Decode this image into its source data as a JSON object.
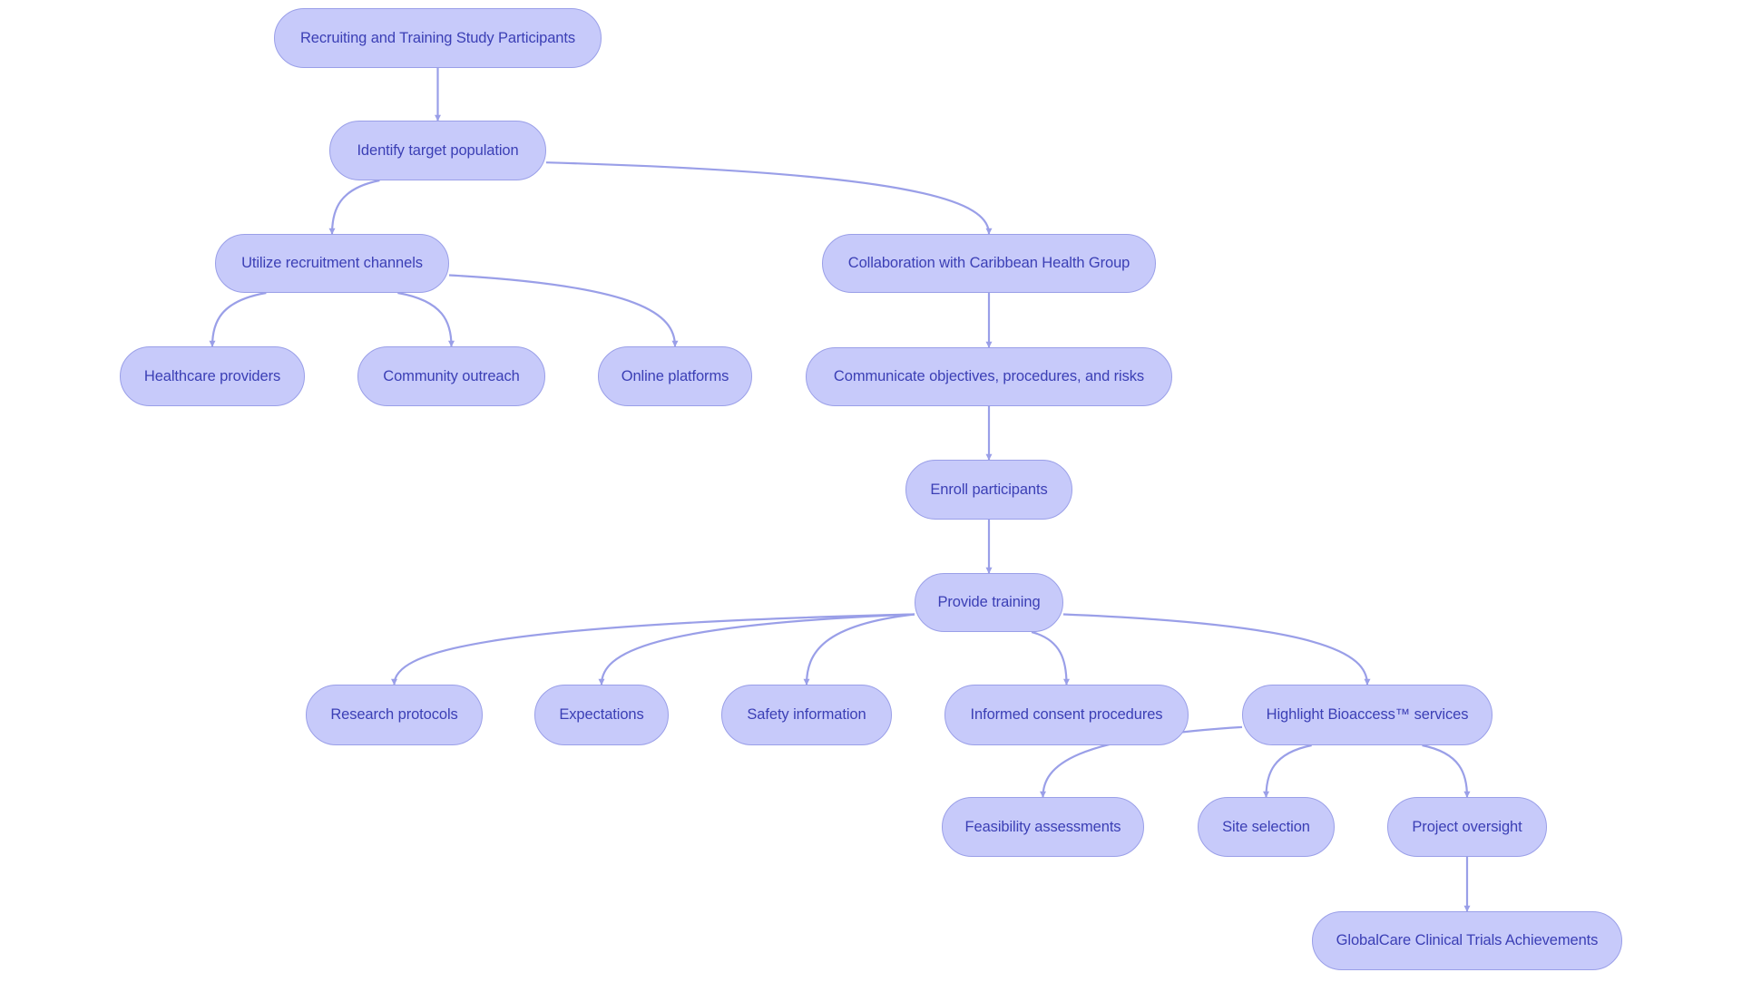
{
  "diagram": {
    "type": "flowchart",
    "direction": "top-down",
    "colors": {
      "node_fill": "#c7cafa",
      "node_border": "#9a9fe8",
      "node_text": "#3b3fb5",
      "edge": "#9a9fe8",
      "background": "#ffffff"
    },
    "nodes": {
      "root": "Recruiting and Training Study Participants",
      "identify": "Identify target population",
      "utilize": "Utilize recruitment channels",
      "collab": "Collaboration with Caribbean Health Group",
      "healthcare": "Healthcare providers",
      "community": "Community outreach",
      "online": "Online platforms",
      "communicate": "Communicate objectives, procedures, and risks",
      "enroll": "Enroll participants",
      "provide": "Provide training",
      "research": "Research protocols",
      "expectations": "Expectations",
      "safety": "Safety information",
      "informed": "Informed consent procedures",
      "highlight": "Highlight Bioaccess™ services",
      "feasibility": "Feasibility assessments",
      "site": "Site selection",
      "project": "Project oversight",
      "globalcare": "GlobalCare Clinical Trials Achievements"
    },
    "edges": [
      {
        "from": "root",
        "to": "identify"
      },
      {
        "from": "identify",
        "to": "utilize"
      },
      {
        "from": "identify",
        "to": "collab"
      },
      {
        "from": "utilize",
        "to": "healthcare"
      },
      {
        "from": "utilize",
        "to": "community"
      },
      {
        "from": "utilize",
        "to": "online"
      },
      {
        "from": "collab",
        "to": "communicate"
      },
      {
        "from": "communicate",
        "to": "enroll"
      },
      {
        "from": "enroll",
        "to": "provide"
      },
      {
        "from": "provide",
        "to": "research"
      },
      {
        "from": "provide",
        "to": "expectations"
      },
      {
        "from": "provide",
        "to": "safety"
      },
      {
        "from": "provide",
        "to": "informed"
      },
      {
        "from": "provide",
        "to": "highlight"
      },
      {
        "from": "highlight",
        "to": "feasibility"
      },
      {
        "from": "highlight",
        "to": "site"
      },
      {
        "from": "highlight",
        "to": "project"
      },
      {
        "from": "project",
        "to": "globalcare"
      }
    ]
  }
}
